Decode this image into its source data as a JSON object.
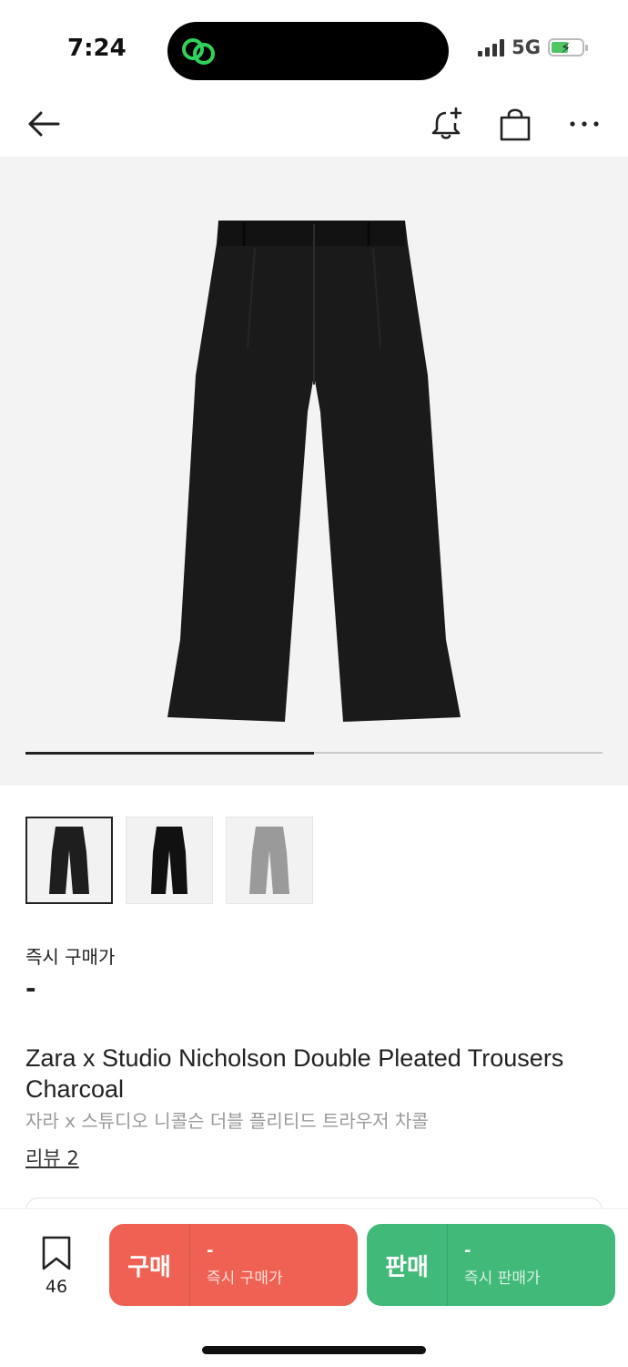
{
  "status_bar": {
    "time": "7:24",
    "network": "5G",
    "icons": [
      "signal-icon",
      "battery-charging-icon"
    ]
  },
  "nav": {
    "icons": [
      "back-arrow-icon",
      "bell-plus-icon",
      "shopping-bag-icon",
      "more-icon"
    ]
  },
  "product": {
    "image_progress": 0.5,
    "thumbnails": [
      {
        "name": "thumbnail-charcoal",
        "color": "#1e1e1e"
      },
      {
        "name": "thumbnail-black",
        "color": "#111111"
      },
      {
        "name": "thumbnail-grey",
        "color": "#9a9a9a"
      }
    ],
    "price_label": "즉시 구매가",
    "price_value": "-",
    "title": "Zara x Studio Nicholson Double Pleated Trousers Charcoal",
    "title_ko": "자라 x 스튜디오 니콜슨 더블 플리티드 트라우저 차콜",
    "review_link": "리뷰 2"
  },
  "bottom_bar": {
    "bookmark_count": "46",
    "buy": {
      "label": "구매",
      "price": "-",
      "sub": "즉시 구매가",
      "color": "#ef6253"
    },
    "sell": {
      "label": "판매",
      "price": "-",
      "sub": "즉시 판매가",
      "color": "#41b979"
    }
  }
}
